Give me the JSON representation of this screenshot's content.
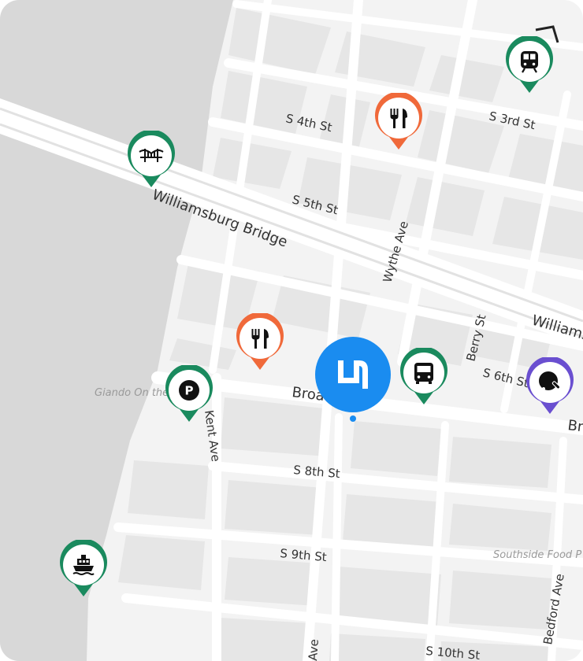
{
  "map": {
    "streets": {
      "s4th": "S 4th St",
      "s3rd": "S 3rd St",
      "s5th": "S 5th St",
      "williamsburg_bridge": "Williamsburg Bridge",
      "wythe": "Wythe Ave",
      "williams_partial": "Williams",
      "berry": "Berry St",
      "s6th": "S 6th St",
      "broadway_left": "Broa",
      "broadway_right": "Br",
      "kent": "Kent Ave",
      "s8th": "S 8th St",
      "s9th": "S 9th St",
      "s10th": "S 10th St",
      "bedford": "Bedford Ave",
      "ave_bottom": "Ave"
    },
    "pois": {
      "giando": "Giando On the",
      "southside": "Southside Food P"
    }
  },
  "markers": [
    {
      "name": "subway-marker",
      "icon": "subway-icon",
      "color": "#1a8a5e"
    },
    {
      "name": "restaurant-marker-top",
      "icon": "restaurant-icon",
      "color": "#f0693a"
    },
    {
      "name": "bridge-marker",
      "icon": "bridge-icon",
      "color": "#1a8a5e"
    },
    {
      "name": "restaurant-marker-mid",
      "icon": "restaurant-icon",
      "color": "#f0693a"
    },
    {
      "name": "bus-marker",
      "icon": "bus-icon",
      "color": "#1a8a5e"
    },
    {
      "name": "parking-marker",
      "icon": "parking-icon",
      "color": "#1a8a5e"
    },
    {
      "name": "activity-marker",
      "icon": "ping-pong-icon",
      "color": "#6a4fd0"
    },
    {
      "name": "ferry-marker",
      "icon": "ferry-icon",
      "color": "#1a8a5e"
    }
  ],
  "center": {
    "icon": "brand-logo-icon",
    "color": "#1a8cf0"
  },
  "colors": {
    "water": "#d8d8d8",
    "land": "#f3f3f3",
    "block": "#e6e6e6",
    "road": "#ffffff"
  }
}
